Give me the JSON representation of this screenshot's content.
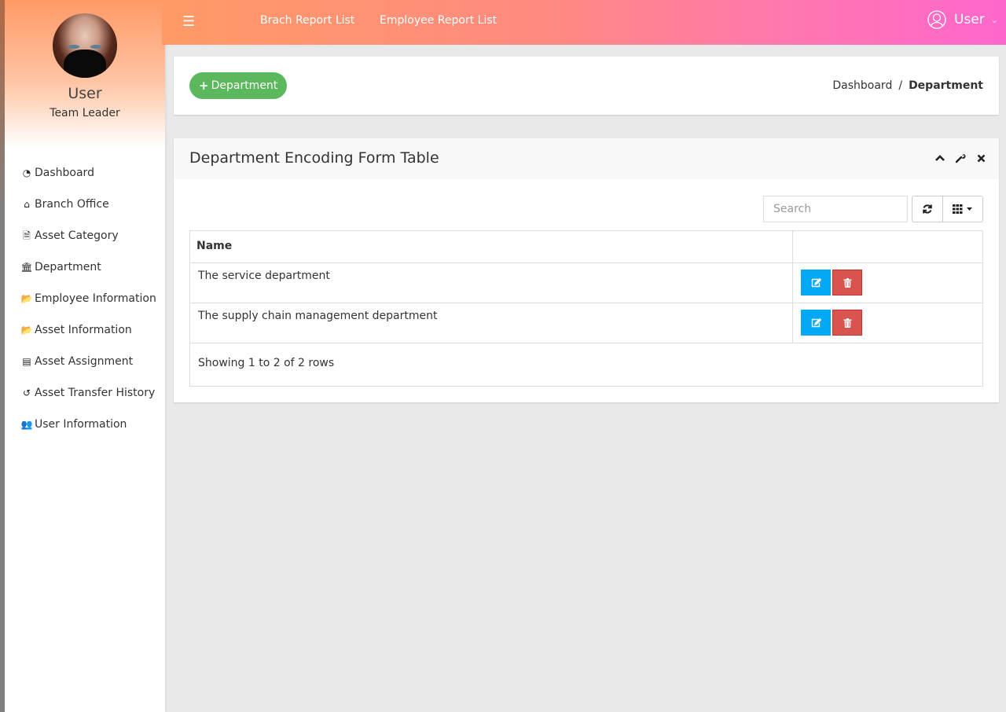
{
  "topbar": {
    "links": [
      "Brach Report List",
      "Employee Report List"
    ],
    "user_label": "User",
    "colors": {
      "start": "#ff9a66",
      "end": "#ff66cc"
    }
  },
  "sidebar": {
    "profile": {
      "name": "User",
      "role": "Team Leader"
    },
    "items": [
      {
        "label": "Dashboard",
        "icon": "dashboard-icon"
      },
      {
        "label": "Branch Office",
        "icon": "home-icon"
      },
      {
        "label": "Asset Category",
        "icon": "file-icon"
      },
      {
        "label": "Department",
        "icon": "bank-icon"
      },
      {
        "label": "Employee Information",
        "icon": "folder-open-icon"
      },
      {
        "label": "Asset Information",
        "icon": "folder-open-icon"
      },
      {
        "label": "Asset Assignment",
        "icon": "list-alt-icon"
      },
      {
        "label": "Asset Transfer History",
        "icon": "history-icon"
      },
      {
        "label": "User Information",
        "icon": "users-icon"
      }
    ]
  },
  "header_panel": {
    "add_button_label": "Department",
    "breadcrumb": {
      "parent": "Dashboard",
      "separator": "/",
      "current": "Department"
    }
  },
  "main_panel": {
    "title": "Department Encoding Form Table",
    "search": {
      "placeholder": "Search",
      "value": ""
    },
    "table": {
      "columns": [
        "Name",
        ""
      ],
      "rows": [
        {
          "name": "The service department"
        },
        {
          "name": "The supply chain management department"
        }
      ],
      "footer": "Showing 1 to 2 of 2 rows"
    },
    "colors": {
      "add": "#5cb85c",
      "edit": "#03a9f4",
      "delete": "#d9534f"
    }
  }
}
